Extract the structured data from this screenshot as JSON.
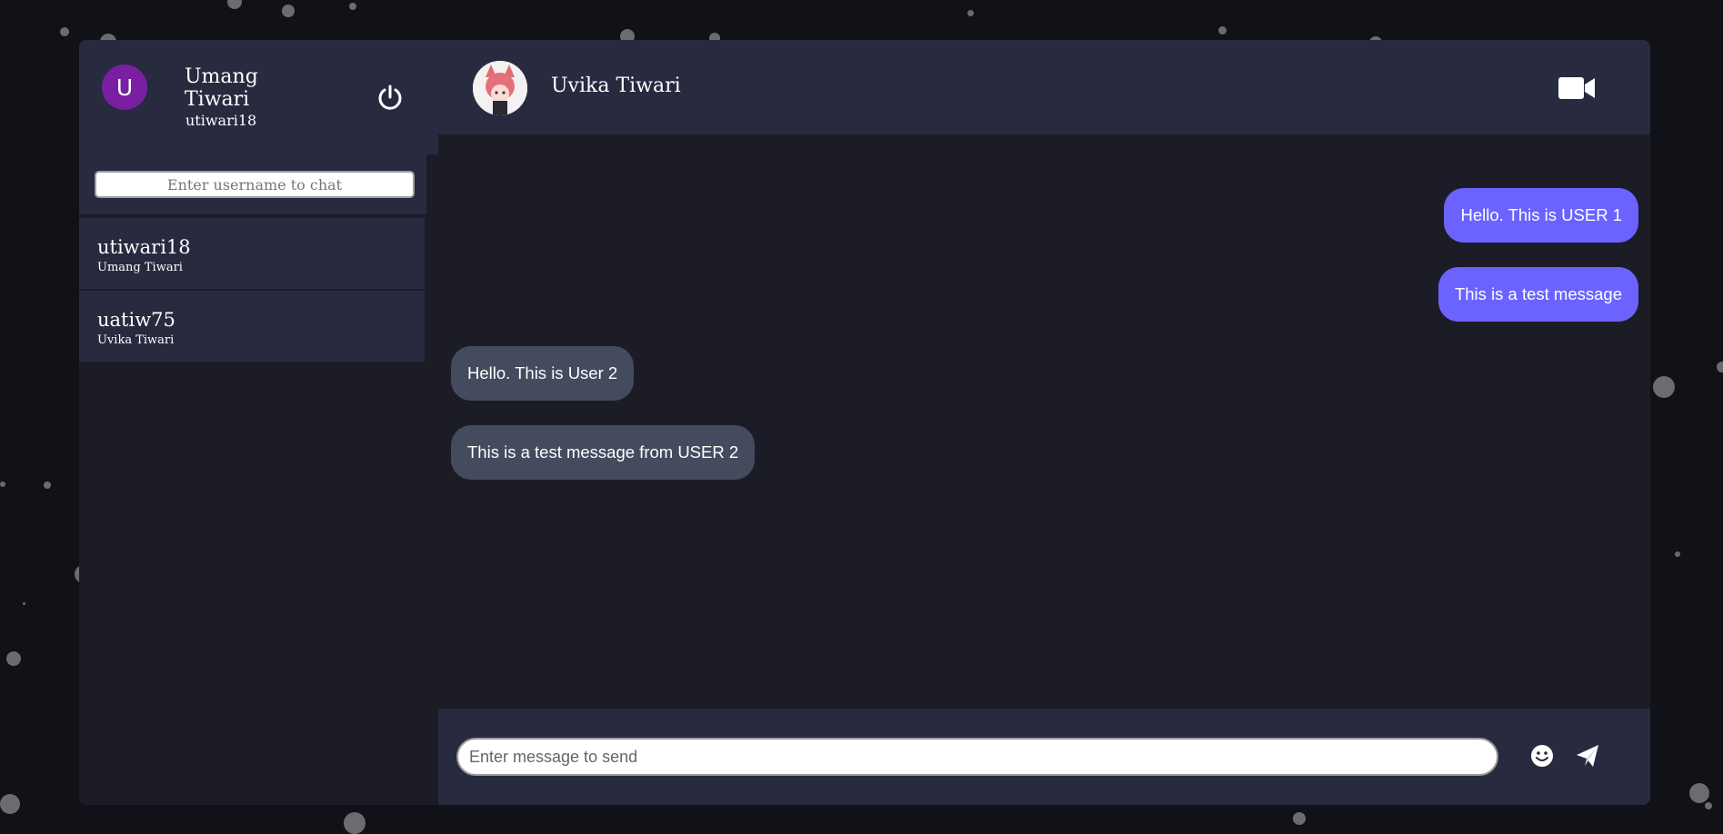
{
  "profile": {
    "initial": "U",
    "full_name": "Umang Tiwari",
    "username": "utiwari18",
    "logout_icon": "power-icon"
  },
  "search": {
    "placeholder": "Enter username to chat",
    "value": ""
  },
  "contacts": [
    {
      "username": "utiwari18",
      "name": "Umang Tiwari"
    },
    {
      "username": "uatiw75",
      "name": "Uvika Tiwari"
    }
  ],
  "chat_header": {
    "partner_name": "Uvika Tiwari",
    "video_icon": "video-camera-icon"
  },
  "messages": [
    {
      "text": "Hello. This is USER 1",
      "direction": "outgoing"
    },
    {
      "text": "This is a test message",
      "direction": "outgoing"
    },
    {
      "text": "Hello. This is User 2",
      "direction": "incoming"
    },
    {
      "text": "This is a test message from USER 2",
      "direction": "incoming"
    }
  ],
  "composer": {
    "placeholder": "Enter message to send",
    "value": "",
    "emoji_icon": "smiley-icon",
    "send_icon": "paper-plane-icon"
  },
  "colors": {
    "page_background": "#111217",
    "panel_dark": "#1c1c27",
    "panel_light": "#282a3f",
    "outgoing_bubble": "#6c63ff",
    "incoming_bubble": "#444b5e",
    "avatar": "#7b1fa2"
  }
}
